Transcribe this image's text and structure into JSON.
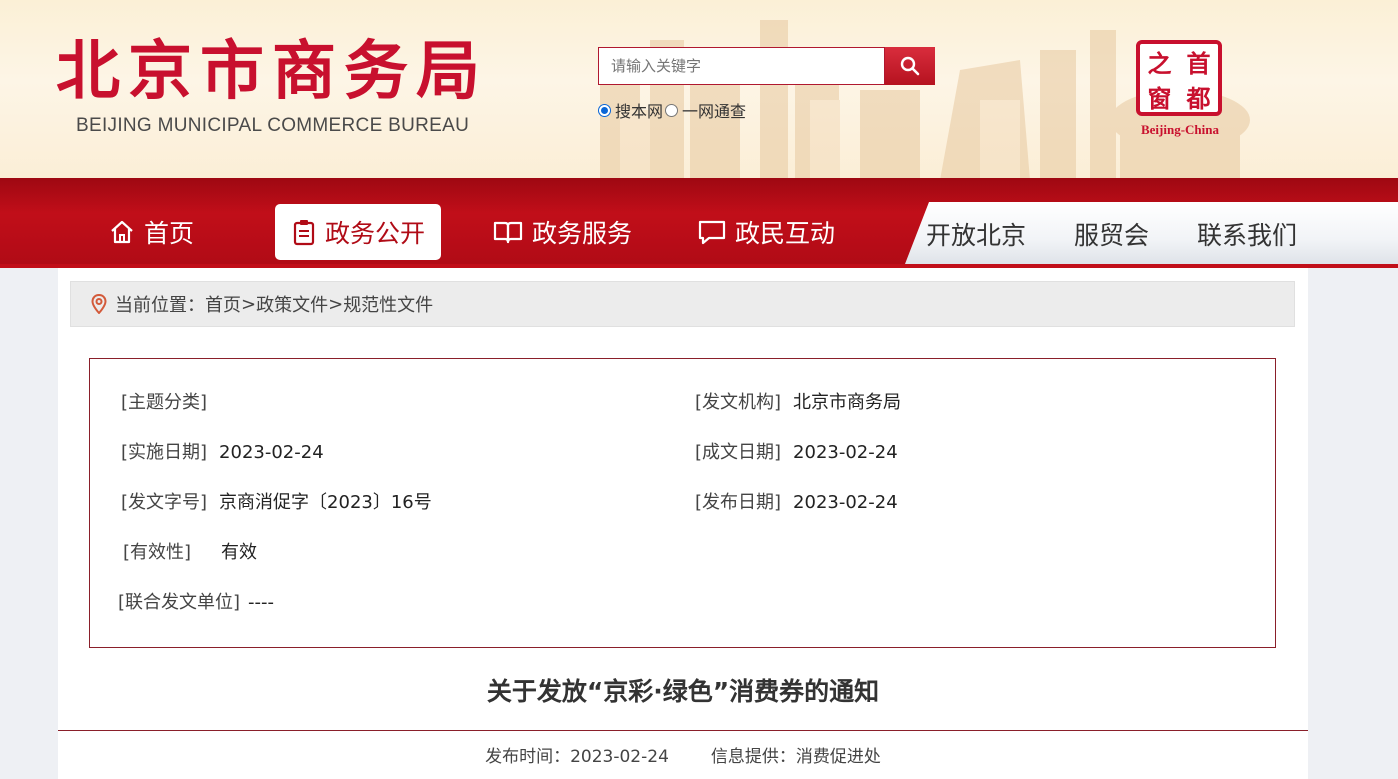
{
  "header": {
    "logo_cn": "北京市商务局",
    "logo_en": "BEIJING MUNICIPAL COMMERCE BUREAU",
    "search": {
      "placeholder": "请输入关键字",
      "button_icon": "search-icon"
    },
    "scope_options": [
      {
        "label": "搜本网",
        "checked": true
      },
      {
        "label": "一网通查",
        "checked": false
      }
    ],
    "seal": {
      "chars": [
        "之",
        "首",
        "窗",
        "都"
      ],
      "caption": "Beijing-China"
    }
  },
  "nav": {
    "primary": [
      {
        "label": "首页",
        "icon": "home-icon",
        "active": false
      },
      {
        "label": "政务公开",
        "icon": "clipboard-icon",
        "active": true
      },
      {
        "label": "政务服务",
        "icon": "book-icon",
        "active": false
      },
      {
        "label": "政民互动",
        "icon": "chat-icon",
        "active": false
      }
    ],
    "secondary": [
      {
        "label": "开放北京"
      },
      {
        "label": "服贸会"
      },
      {
        "label": "联系我们"
      }
    ]
  },
  "breadcrumb": {
    "prefix": "当前位置：",
    "items": [
      "首页",
      "政策文件",
      "规范性文件"
    ],
    "separator": ">"
  },
  "meta": {
    "subject": {
      "label": "[主题分类]",
      "value": ""
    },
    "issuer": {
      "label": "[发文机构]",
      "value": "北京市商务局"
    },
    "effective_date": {
      "label": "[实施日期]",
      "value": "2023-02-24"
    },
    "written_date": {
      "label": "[成文日期]",
      "value": "2023-02-24"
    },
    "doc_number": {
      "label": "[发文字号]",
      "value": "京商消促字〔2023〕16号"
    },
    "publish_date": {
      "label": "[发布日期]",
      "value": "2023-02-24"
    },
    "validity": {
      "label": "[有效性]",
      "value": "有效"
    },
    "joint_issuer": {
      "label": "[联合发文单位]",
      "value": "----"
    }
  },
  "article": {
    "title": "关于发放“京彩·绿色”消费券的通知",
    "publish_time": "发布时间：2023-02-24",
    "provider": "信息提供：消费促进处"
  },
  "colors": {
    "brand_red": "#c10e19",
    "dark_red": "#8a1f2a",
    "seal_red": "#c8102e"
  }
}
